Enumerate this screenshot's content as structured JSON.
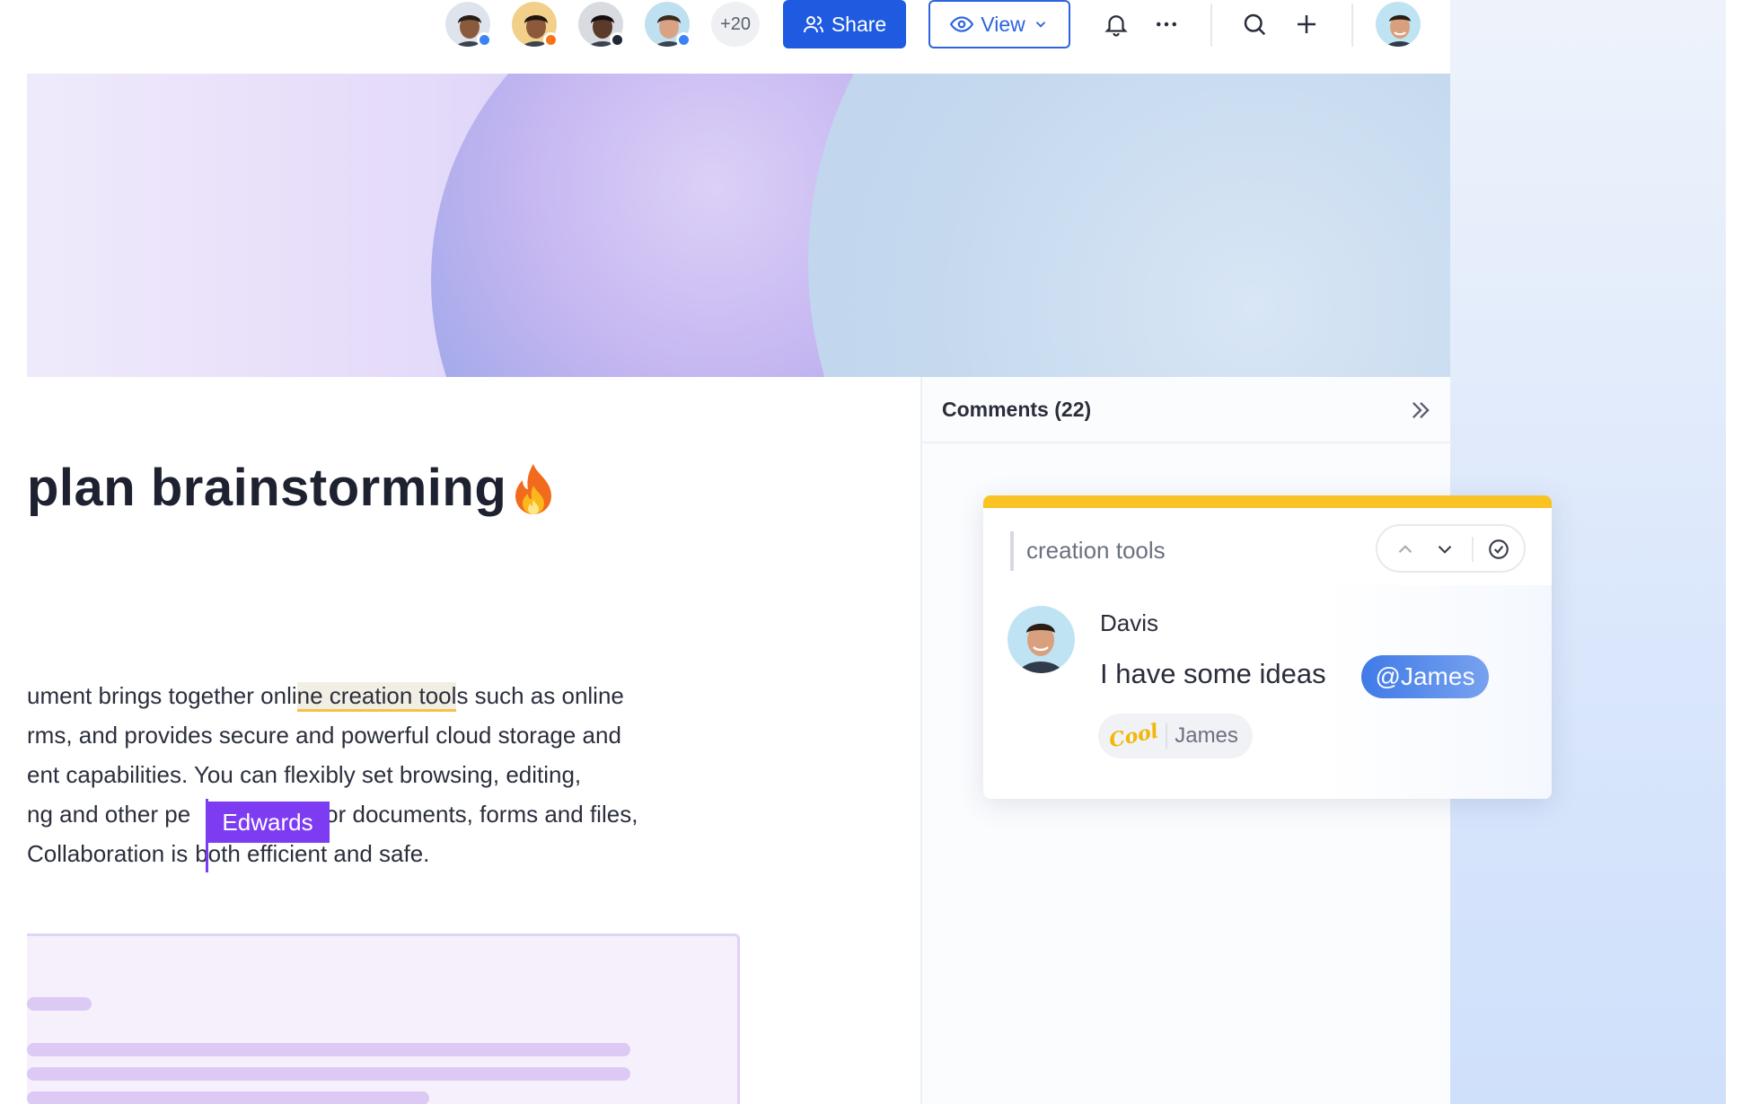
{
  "topbar": {
    "collaborators": [
      {
        "name": "collaborator-1",
        "status_color": "#3b82f6",
        "skin": "#8a5a3c",
        "hair": "#2a1d16",
        "bg": "#dfe4ec"
      },
      {
        "name": "collaborator-2",
        "status_color": "#f97316",
        "skin": "#8c5a3a",
        "hair": "#1f1510",
        "bg": "#f2d08a"
      },
      {
        "name": "collaborator-3",
        "status_color": "#1f2937",
        "skin": "#5b3a2a",
        "hair": "#151010",
        "bg": "#d8dbe0"
      },
      {
        "name": "collaborator-4",
        "status_color": "#3b82f6",
        "skin": "#d9a383",
        "hair": "#3a2a20",
        "bg": "#bfe0f0"
      }
    ],
    "more_count": "+20",
    "share_label": "Share",
    "view_label": "View",
    "colors": {
      "primary": "#1f5be0",
      "view_outline": "#2d63e0"
    }
  },
  "document": {
    "title": "plan brainstorming",
    "paragraph": {
      "line1_before": "ument brings together onli",
      "line1_highlight_pre": "ne ",
      "line1_highlight": "creation too",
      "line1_highlight_post": "l",
      "line1_after": "s such as online",
      "line2": "rms, and provides secure and powerful cloud storage and",
      "line3": "ent capabilities. You can flexibly set browsing, editing,",
      "line4_before": "ng and other pe",
      "line4_after": "or documents, forms and files,",
      "line5_before": "Collaboration is",
      "line5_after": "both efficient and safe."
    },
    "cursor_user": "Edwards",
    "cursor_color": "#7d3cf2"
  },
  "comments": {
    "header": "Comments (22)",
    "card": {
      "quote": "creation tools",
      "author": "Davis",
      "body": "I have some ideas",
      "mention": "@James",
      "reaction_emoji": "Cool",
      "reaction_user": "James",
      "accent_color": "#f8c323",
      "mention_color": "#2f6fe6"
    }
  },
  "icons": [
    "share-person-icon",
    "eye-icon",
    "chevron-down-icon",
    "bell-icon",
    "more-icon",
    "search-icon",
    "plus-icon",
    "flame-icon",
    "collapse-icon",
    "chevron-up-icon",
    "resolve-check-icon"
  ]
}
